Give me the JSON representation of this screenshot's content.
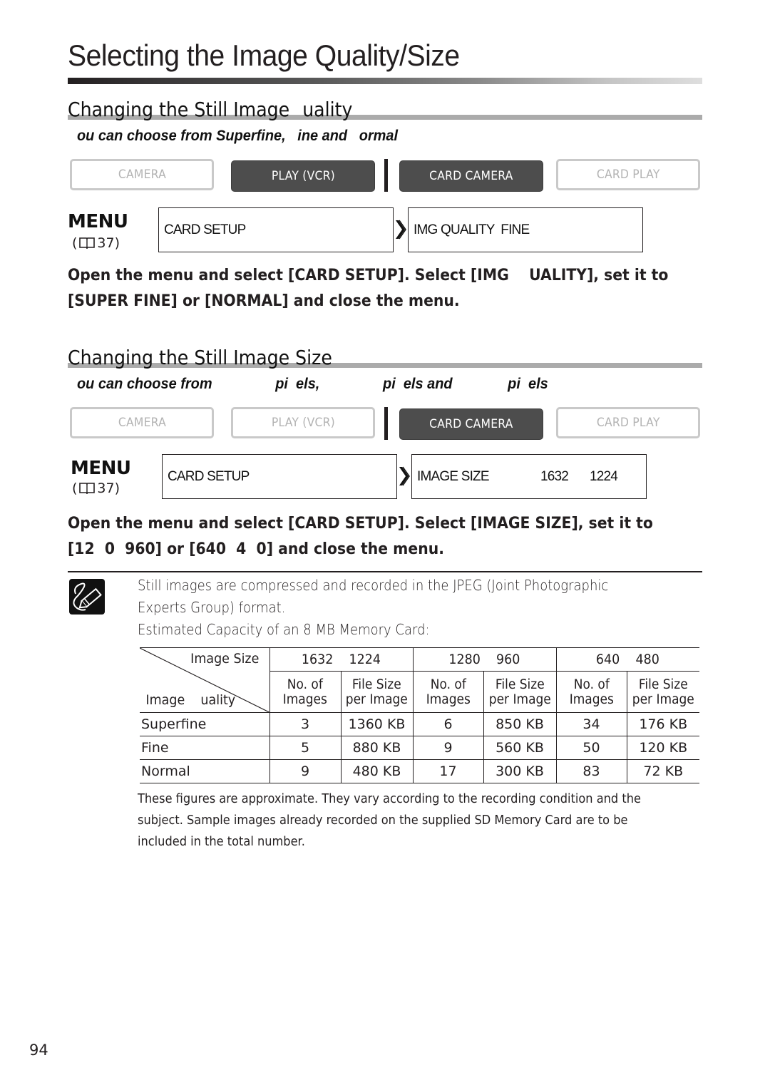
{
  "page": {
    "title": "Selecting the Image Quality/Size",
    "page_number": "94"
  },
  "quality_section": {
    "title": "Changing the Still Image   uality",
    "subtitle": "ou can choose from Superfine,   ine and   ormal",
    "modes": [
      {
        "label": "CAMERA",
        "active": false
      },
      {
        "label": "PLAY (VCR)",
        "active": true
      },
      {
        "label": "CARD CAMERA",
        "active": true
      },
      {
        "label": "CARD PLAY",
        "active": false
      }
    ],
    "menu": {
      "label": "MENU",
      "ref_open": "(",
      "ref_page": "37)",
      "box1": "CARD SETUP",
      "box2": "IMG QUALITY  FINE"
    },
    "instruction": "Open the menu and select [CARD SETUP]. Select [IMG    UALITY], set it to\n[SUPER FINE] or [NORMAL] and close the menu."
  },
  "size_section": {
    "title": "Changing the Still Image Size",
    "subtitle": "ou can choose from                pi  els,                pi  els and              pi  els",
    "modes": [
      {
        "label": "CAMERA",
        "active": false
      },
      {
        "label": "PLAY (VCR)",
        "active": false
      },
      {
        "label": "CARD CAMERA",
        "active": true
      },
      {
        "label": "CARD PLAY",
        "active": false
      }
    ],
    "menu": {
      "label": "MENU",
      "ref_open": "(",
      "ref_page": "37)",
      "box1": "CARD SETUP",
      "box2_label": "IMAGE SIZE",
      "box2_w": "1632",
      "box2_h": "1224"
    },
    "instruction": "Open the menu and select [CARD SETUP]. Select [IMAGE SIZE], set it to\n[12  0  960] or [640  4  0] and close the menu."
  },
  "note": {
    "icon": "pencil-note-icon",
    "text1": "Still images are compressed and recorded in the JPEG (Joint Photographic\nExperts Group) format.",
    "text2": "Estimated Capacity of an 8 MB Memory Card:"
  },
  "capacity_table": {
    "corner_size_label": "Image Size",
    "corner_quality_label": "Image    uality",
    "sizes": [
      "1632    1224",
      "1280    960",
      "640    480"
    ],
    "subheaders": {
      "count": [
        "No. of",
        "Images"
      ],
      "filesize": [
        "File Size",
        "per Image"
      ]
    },
    "rows": [
      {
        "quality": "Superfine",
        "values": [
          "3",
          "1360 KB",
          "6",
          "850 KB",
          "34",
          "176 KB"
        ]
      },
      {
        "quality": "Fine",
        "values": [
          "5",
          "880 KB",
          "9",
          "560 KB",
          "50",
          "120 KB"
        ]
      },
      {
        "quality": "Normal",
        "values": [
          "9",
          "480 KB",
          "17",
          "300 KB",
          "83",
          "72 KB"
        ]
      }
    ]
  },
  "footnote": "These figures are approximate. They vary according to the recording condition and the\nsubject. Sample images already recorded on the supplied SD Memory Card are to be\nincluded in the total number."
}
